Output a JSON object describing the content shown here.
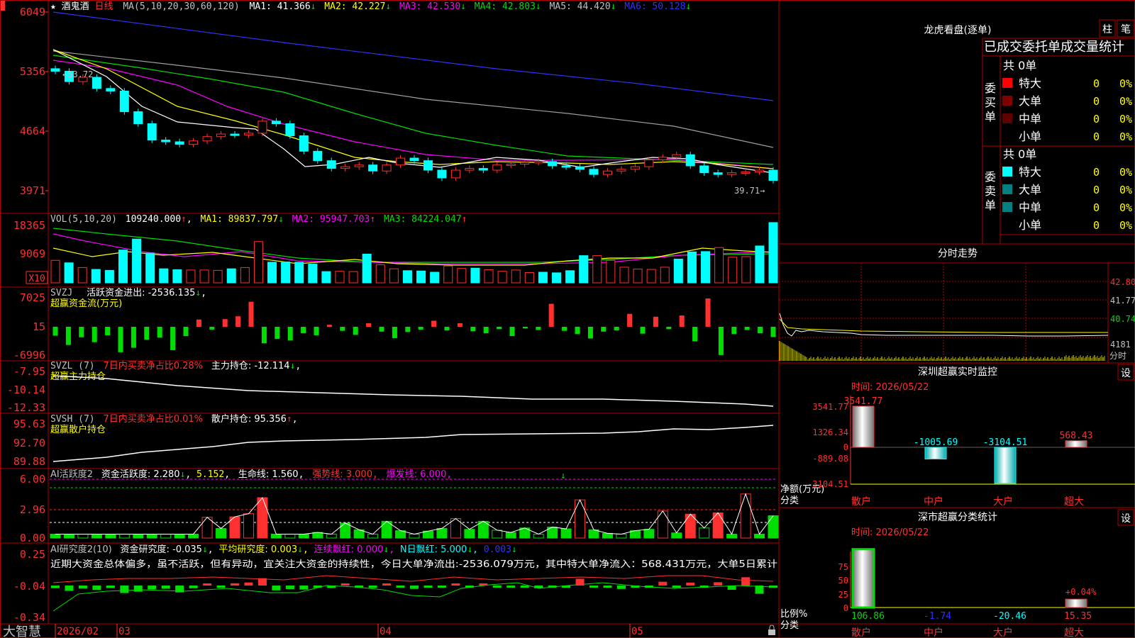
{
  "colors": {
    "up": "#ff3030",
    "down": "#00ffff",
    "green": "#00dd00",
    "grid": "#b00000",
    "yellow": "#ffff00",
    "white": "#ffffff",
    "magenta": "#ff00ff",
    "blue": "#3030ff",
    "gray": "#a0a0a0",
    "text_gray": "#c0c0c0"
  },
  "stock": {
    "star": "★",
    "name": "酒鬼酒",
    "period": "日线"
  },
  "price_panel": {
    "ma_title": "MA(5,10,20,30,60,120)",
    "ma_values": [
      {
        "label": "MA1: 41.366",
        "arrow": "↓",
        "color": "#ffffff"
      },
      {
        "label": "MA2: 42.227",
        "arrow": "↓",
        "color": "#ffff00"
      },
      {
        "label": "MA3: 42.530",
        "arrow": "↓",
        "color": "#ff00ff"
      },
      {
        "label": "MA4: 42.803",
        "arrow": "↓",
        "color": "#00dd00"
      },
      {
        "label": "MA5: 44.420",
        "arrow": "↓",
        "color": "#c0c0c0"
      },
      {
        "label": "MA6: 50.128",
        "arrow": "↓",
        "color": "#3030ff"
      }
    ],
    "axis_ticks": [
      "6049",
      "5356",
      "4664",
      "3971"
    ],
    "high_mark": "←53.72",
    "low_mark": "39.71→"
  },
  "vol_panel": {
    "title": "VOL(5,10,20)",
    "value": "109240.000",
    "arrow": "↑",
    "ma1": "MA1: 89837.797",
    "ma1_arrow": "↓",
    "ma2": "MA2: 95947.703",
    "ma2_arrow": "↑",
    "ma3": "MA3: 84224.047",
    "ma3_arrow": "↑",
    "axis_ticks": [
      "18365",
      "9069"
    ],
    "unit": "X10"
  },
  "svzj_panel": {
    "title": "SVZJ",
    "label": "活跃资金进出: -2536.135",
    "arrow": "↓",
    "sub": "超赢资金流(万元)",
    "axis_ticks": [
      "7025",
      "15",
      "-6996"
    ]
  },
  "svzl_panel": {
    "title": "SVZL (7)",
    "ratio": "7日内买卖净占比0.28%",
    "label": "主力持仓: -12.114",
    "arrow": "↓",
    "sub": "超赢主力持仓",
    "axis_ticks": [
      "-7.95",
      "-10.14",
      "-12.33"
    ]
  },
  "svsh_panel": {
    "title": "SVSH (7)",
    "ratio": "7日内买卖净占比0.01%",
    "label": "散户持仓: 95.356",
    "arrow": "↑",
    "sub": "超赢散户持仓",
    "axis_ticks": [
      "95.63",
      "92.70",
      "89.88"
    ]
  },
  "ai_active_panel": {
    "title": "AI活跃度2",
    "label1": "资金活跃度: 2.280",
    "arrow1": "↓",
    "val2": "5.152",
    "label3": "生命线: 1.560",
    "label4": "强势线: 3.000",
    "label5": "爆发线: 6.000",
    "axis_ticks": [
      "6.00",
      "2.96",
      "0.00"
    ]
  },
  "ai_research_panel": {
    "title": "AI研究度2(10)",
    "label1": "资金研究度: -0.035",
    "arrow1": "↓",
    "label2": "平均研究度: 0.003",
    "arrow2": "↓",
    "label3": "连续飘红: 0.000",
    "arrow3": "↓",
    "label4": "N日飘红: 5.000",
    "arrow4": "↓",
    "val5": "0.003",
    "arrow5": "↓",
    "comment": "近期大资金总体偏多，虽不活跃，但有异动，宜关注大资金的持续性，今日大单净流出:-2536.079万元，其中特大单净流入：568.431万元，大单5日累计",
    "axis_ticks": [
      "0.25",
      "-0.04",
      "-0.34"
    ]
  },
  "bottom_bar": {
    "brand": "大智慧",
    "dates": [
      "2026/02",
      "03",
      "04",
      "05"
    ]
  },
  "dragon": {
    "title": "龙虎看盘(逐单)",
    "btn1": "柱",
    "btn2": "笔",
    "header": "已成交委托单成交量统计",
    "buy": {
      "side": "委买单",
      "total": "共 0单",
      "rows": [
        {
          "name": "特大",
          "val": "0",
          "pct": "0%",
          "color": "#ff0000"
        },
        {
          "name": "大单",
          "val": "0",
          "pct": "0%",
          "color": "#800000"
        },
        {
          "name": "中单",
          "val": "0",
          "pct": "0%",
          "color": "#600000"
        },
        {
          "name": "小单",
          "val": "0",
          "pct": "0%",
          "color": ""
        }
      ]
    },
    "sell": {
      "side": "委卖单",
      "total": "共 0单",
      "rows": [
        {
          "name": "特大",
          "val": "0",
          "pct": "0%",
          "color": "#00ffff"
        },
        {
          "name": "大单",
          "val": "0",
          "pct": "0%",
          "color": "#008080"
        },
        {
          "name": "中单",
          "val": "0",
          "pct": "0%",
          "color": "#008080"
        },
        {
          "name": "小单",
          "val": "0",
          "pct": "0%",
          "color": ""
        }
      ]
    }
  },
  "intraday": {
    "title": "分时走势",
    "ticks": [
      "42.80",
      "41.77",
      "40.74"
    ],
    "vol_tick": "4181",
    "vol_label": "分时"
  },
  "sz_monitor": {
    "title": "深圳超赢实时监控",
    "btn": "设",
    "time": "时间: 2026/05/22",
    "axis_ticks": [
      "3541.77",
      "1326.34",
      "0",
      "-889.08",
      "-3104.51"
    ],
    "y_label": "净额(万元)",
    "x_label": "分类",
    "chart_data": {
      "type": "bar",
      "categories": [
        "散户",
        "中户",
        "大户",
        "超大"
      ],
      "values": [
        3541.77,
        -1005.69,
        -3104.51,
        568.43
      ],
      "labels": [
        "3541.77",
        "-1005.69",
        "-3104.51",
        "568.43"
      ],
      "ylim": [
        -3104.51,
        3541.77
      ]
    }
  },
  "sz_class": {
    "title": "深市超赢分类统计",
    "btn": "设",
    "time": "时间: 2026/05/22",
    "axis_ticks": [
      "75",
      "50",
      "25",
      "0"
    ],
    "y_label": "比例%",
    "x_label": "分类",
    "chart_data": {
      "type": "bar",
      "categories": [
        "散户",
        "中户",
        "大户",
        "超大"
      ],
      "values": [
        106.86,
        -1.74,
        -20.46,
        15.35
      ],
      "labels": [
        "106.86",
        "-1.74",
        "-20.46",
        "15.35"
      ],
      "extra_label": "+0.04%",
      "ylim": [
        0,
        100
      ]
    }
  },
  "chart_data": {
    "type": "candlestick",
    "title": "酒鬼酒 日线",
    "x_labels": [
      "2026/02",
      "03",
      "04",
      "05"
    ],
    "ylim": [
      39.71,
      60.49
    ],
    "close": [
      53.6,
      52.4,
      52.9,
      51.6,
      51.3,
      48.9,
      47.5,
      45.6,
      45.4,
      45.1,
      45.5,
      46.0,
      46.3,
      46.2,
      46.4,
      47.8,
      47.5,
      46.1,
      44.3,
      43.2,
      42.3,
      42.5,
      42.7,
      42.0,
      42.7,
      43.5,
      43.2,
      42.1,
      41.2,
      42.1,
      42.3,
      42.1,
      42.7,
      42.8,
      43.0,
      43.1,
      42.6,
      42.5,
      42.2,
      41.6,
      42.0,
      42.2,
      42.5,
      43.3,
      43.6,
      43.9,
      42.6,
      41.8,
      41.6,
      41.8,
      41.9,
      42.1,
      40.9
    ],
    "vol": [
      7200,
      6400,
      4900,
      4300,
      4000,
      10500,
      14000,
      9500,
      4500,
      4200,
      4100,
      4100,
      4000,
      4500,
      4900,
      13200,
      6600,
      6700,
      6600,
      6000,
      3600,
      3700,
      3600,
      9200,
      5800,
      4500,
      3900,
      3800,
      3400,
      5400,
      4600,
      4700,
      4200,
      3700,
      4100,
      3300,
      3400,
      3200,
      3900,
      8700,
      8700,
      7200,
      5000,
      4400,
      4300,
      5000,
      7600,
      9900,
      10000,
      11300,
      8200,
      8400,
      11800,
      109240
    ],
    "fund_flow": [
      -2200,
      -4500,
      -2600,
      -3800,
      -2100,
      -6300,
      -5200,
      -3200,
      -2700,
      -5800,
      -2300,
      1800,
      -700,
      1900,
      2600,
      6200,
      -4100,
      -3000,
      -3400,
      -1600,
      -2100,
      500,
      -1000,
      -2000,
      900,
      -1200,
      -2800,
      -1300,
      -700,
      1500,
      -900,
      900,
      -1100,
      -1600,
      -600,
      -2300,
      -400,
      -800,
      5700,
      -1000,
      -1800,
      -2900,
      -1200,
      -900,
      3200,
      -1700,
      2500,
      -600,
      2800,
      -3600,
      7025,
      -6996,
      -1800,
      -800,
      -1600,
      -2536
    ]
  }
}
